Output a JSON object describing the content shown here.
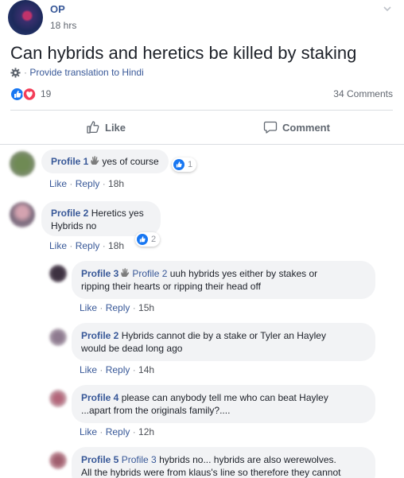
{
  "post": {
    "author": "OP",
    "time": "18 hrs",
    "text": "Can hybrids and heretics be killed by staking",
    "translate": "Provide translation to Hindi",
    "reaction_count": "19",
    "comments_count": "34 Comments",
    "like_label": "Like",
    "comment_label": "Comment"
  },
  "meta_labels": {
    "like": "Like",
    "reply": "Reply",
    "sep": " · "
  },
  "comments": [
    {
      "name": "Profile 1",
      "text": "yes of course",
      "time": "18h",
      "reactions": "1"
    },
    {
      "name": "Profile 2",
      "line1": "Heretics yes",
      "line2": "Hybrids no",
      "time": "18h",
      "reactions": "2"
    }
  ],
  "replies": [
    {
      "name": "Profile 3",
      "mention": "Profile 2",
      "line1": "uuh hybrids yes either by stakes or",
      "line2": "ripping their hearts or ripping their head off",
      "time": "15h"
    },
    {
      "name": "Profile 2",
      "line1": "Hybrids cannot die by a stake or Tyler an Hayley",
      "line2": "would be dead long ago",
      "time": "14h"
    },
    {
      "name": "Profile 4",
      "line1": "please can anybody tell me who can beat Hayley",
      "line2": "...apart from the originals family?....",
      "time": "12h"
    },
    {
      "name": "Profile 5",
      "mention": "Profile 3",
      "line1": "hybrids no... hybrids are also werewolves.",
      "line2": "All the hybrids were from klaus's line so therefore they cannot"
    }
  ],
  "colors": {
    "link": "#385898",
    "like_blue": "#1877f2",
    "love_red": "#f33e58",
    "bubble": "#f2f3f5"
  }
}
